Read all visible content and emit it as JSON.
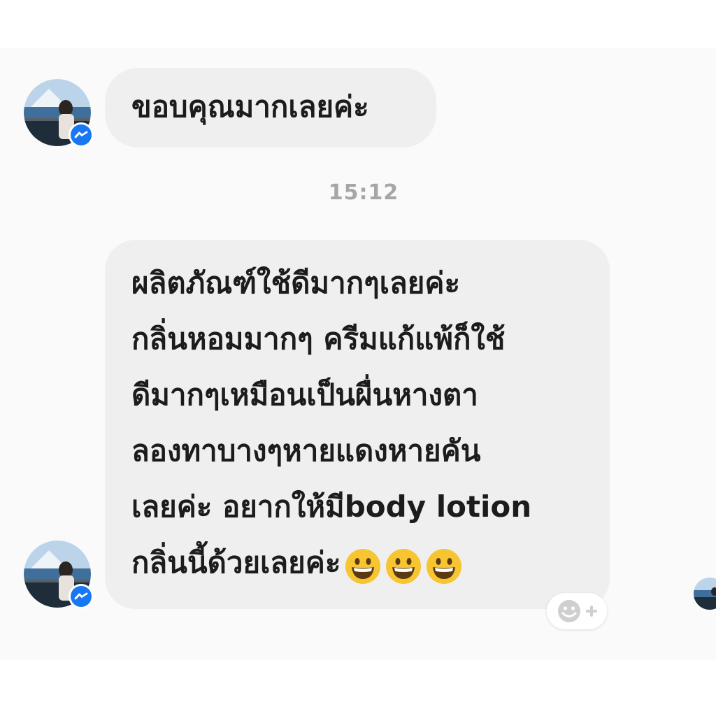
{
  "conversation": {
    "messages": [
      {
        "text_lines": [
          "ขอบคุณมากเลยค่ะ"
        ]
      },
      {
        "text_lines": [
          "ผลิตภัณฑ์ใช้ดีมากๆเลยค่ะ",
          "กลิ่นหอมมากๆ ครีมแก้แพ้ก็ใช้",
          "ดีมากๆเหมือนเป็นผื่นหางตา",
          "ลองทาบางๆหายแดงหายคัน",
          "เลยค่ะ อยากให้มีbody lotion",
          "กลิ่นนี้ด้วยเลยค่ะ"
        ],
        "emojis": [
          "grinning-face",
          "grinning-face",
          "grinning-face"
        ]
      }
    ],
    "timestamp": "15:12"
  },
  "icons": {
    "avatar_badge": "messenger-icon",
    "reaction_button": "add-reaction-icon"
  },
  "colors": {
    "bubble_bg": "#efefef",
    "text": "#1c1c1c",
    "timestamp": "#a6a6a6",
    "messenger_blue": "#1877f2"
  }
}
